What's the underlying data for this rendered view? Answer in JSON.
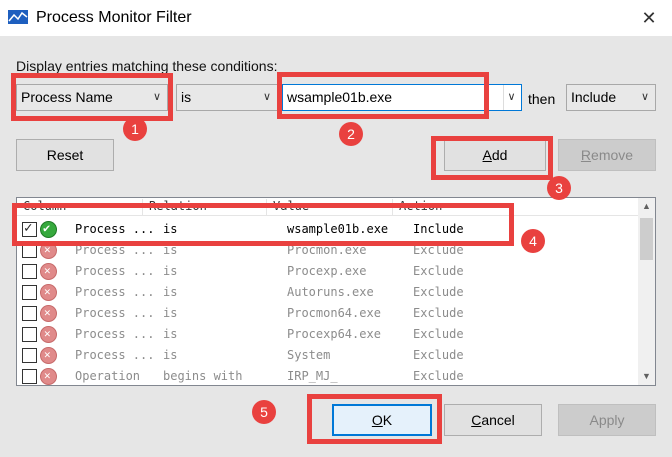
{
  "window": {
    "title": "Process Monitor Filter",
    "close_glyph": "✕"
  },
  "condition": {
    "label": "Display entries matching these conditions:",
    "column": "Process Name",
    "relation": "is",
    "value": "wsample01b.exe",
    "then_label": "then",
    "action": "Include"
  },
  "buttons": {
    "reset": "Reset",
    "add_prefix": "A",
    "add_rest": "dd",
    "remove_prefix": "R",
    "remove_rest": "emove",
    "ok_prefix": "O",
    "ok_rest": "K",
    "cancel_prefix": "C",
    "cancel_rest": "ancel",
    "apply": "Apply"
  },
  "list": {
    "headers": [
      "Column",
      "Relation",
      "Value",
      "Action"
    ],
    "rows": [
      {
        "checked": true,
        "status": "include",
        "column": "Process ...",
        "relation": "is",
        "value": "wsample01b.exe",
        "action": "Include"
      },
      {
        "checked": false,
        "status": "exclude",
        "column": "Process ...",
        "relation": "is",
        "value": "Procmon.exe",
        "action": "Exclude"
      },
      {
        "checked": false,
        "status": "exclude",
        "column": "Process ...",
        "relation": "is",
        "value": "Procexp.exe",
        "action": "Exclude"
      },
      {
        "checked": false,
        "status": "exclude",
        "column": "Process ...",
        "relation": "is",
        "value": "Autoruns.exe",
        "action": "Exclude"
      },
      {
        "checked": false,
        "status": "exclude",
        "column": "Process ...",
        "relation": "is",
        "value": "Procmon64.exe",
        "action": "Exclude"
      },
      {
        "checked": false,
        "status": "exclude",
        "column": "Process ...",
        "relation": "is",
        "value": "Procexp64.exe",
        "action": "Exclude"
      },
      {
        "checked": false,
        "status": "exclude",
        "column": "Process ...",
        "relation": "is",
        "value": "System",
        "action": "Exclude"
      },
      {
        "checked": false,
        "status": "exclude",
        "column": "Operation",
        "relation": "begins with",
        "value": "IRP_MJ_",
        "action": "Exclude"
      }
    ]
  },
  "annotations": [
    "1",
    "2",
    "3",
    "4",
    "5"
  ],
  "colors": {
    "highlight": "#e9413f",
    "accent": "#0078d7"
  }
}
